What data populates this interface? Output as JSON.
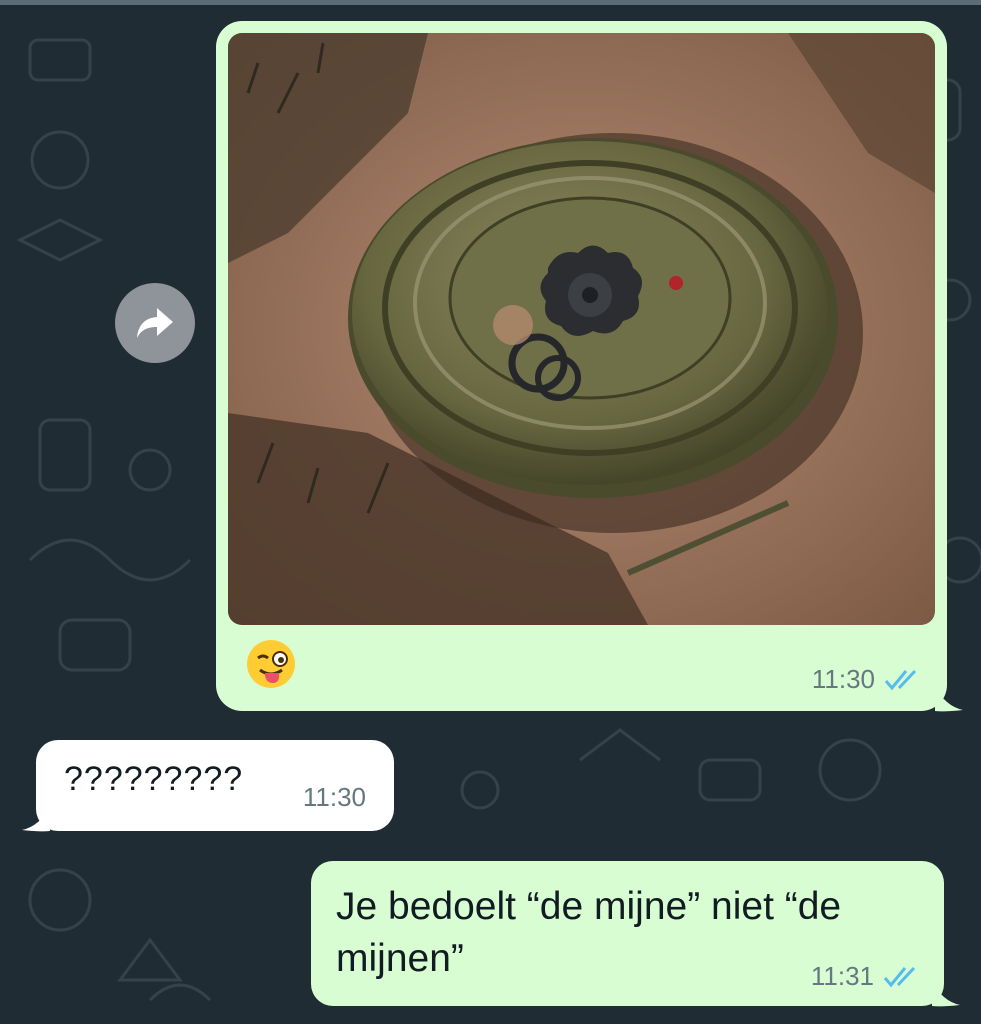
{
  "messages": [
    {
      "type": "image",
      "direction": "outgoing",
      "caption_emoji": "winking-face-with-tongue",
      "time": "11:30",
      "status": "read"
    },
    {
      "type": "text",
      "direction": "incoming",
      "text": "?????????",
      "time": "11:30"
    },
    {
      "type": "text",
      "direction": "outgoing",
      "text": "Je bedoelt “de mijne” niet “de mijnen”",
      "time": "11:31",
      "status": "read"
    }
  ],
  "colors": {
    "background": "#1f2c34",
    "outgoing_bubble": "#d9fdd3",
    "incoming_bubble": "#ffffff",
    "read_ticks": "#53bdeb",
    "timestamp": "#667781"
  },
  "icons": {
    "forward": "forward-arrow-icon",
    "ticks": "double-check-icon"
  }
}
